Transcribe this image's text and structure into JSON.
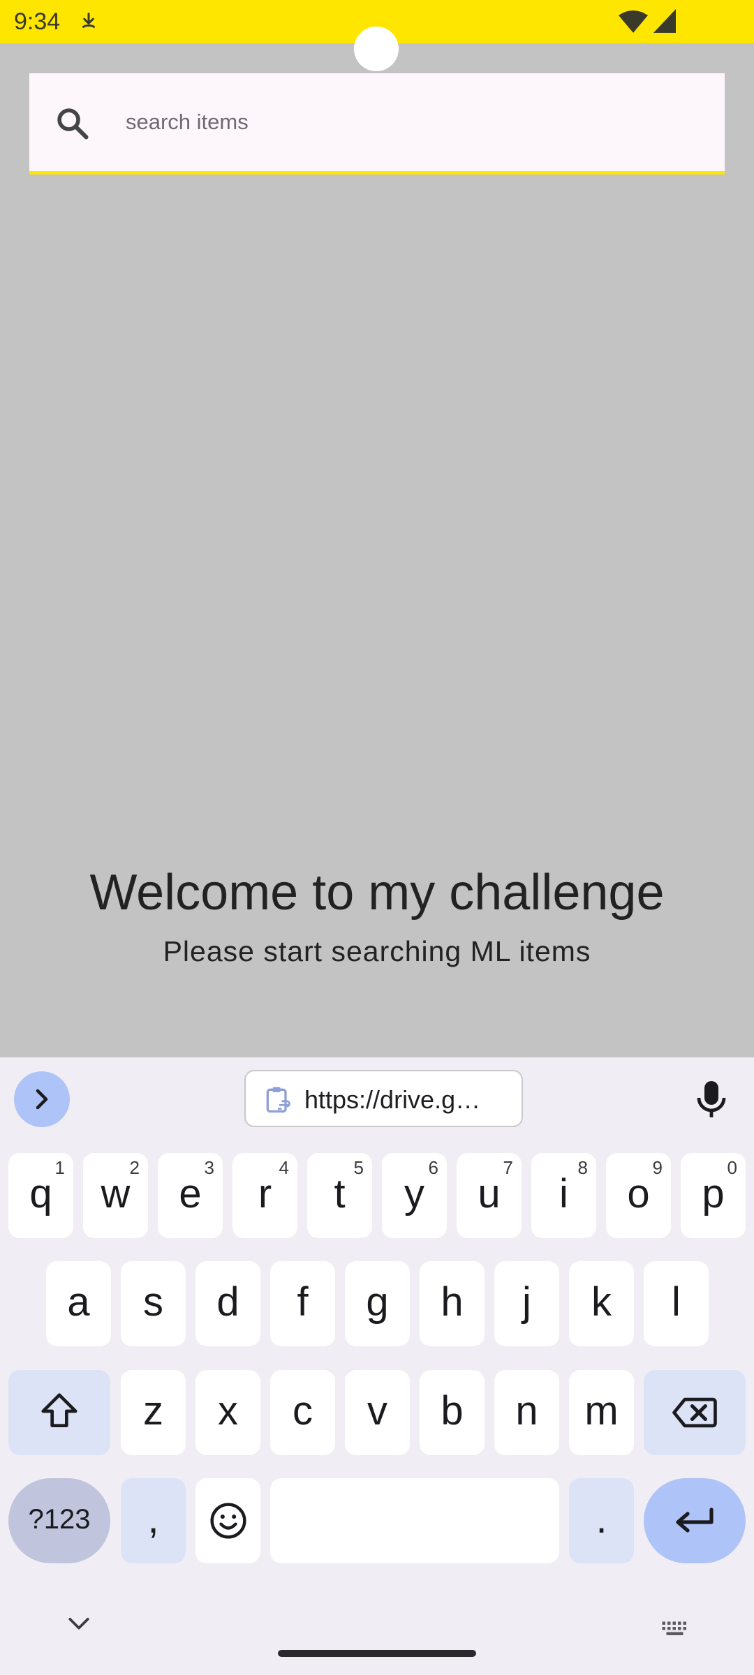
{
  "status_bar": {
    "time": "9:34",
    "icons": [
      "download-progress-icon",
      "wifi-icon",
      "cell-signal-icon"
    ]
  },
  "search": {
    "placeholder": "search items",
    "value": "",
    "icon": "search-icon"
  },
  "welcome": {
    "title": "Welcome to my challenge",
    "subtitle": "Please start searching ML items"
  },
  "keyboard": {
    "clipboard_suggestion": "https://drive.g…",
    "rows": [
      [
        {
          "label": "q",
          "hint": "1"
        },
        {
          "label": "w",
          "hint": "2"
        },
        {
          "label": "e",
          "hint": "3"
        },
        {
          "label": "r",
          "hint": "4"
        },
        {
          "label": "t",
          "hint": "5"
        },
        {
          "label": "y",
          "hint": "6"
        },
        {
          "label": "u",
          "hint": "7"
        },
        {
          "label": "i",
          "hint": "8"
        },
        {
          "label": "o",
          "hint": "9"
        },
        {
          "label": "p",
          "hint": "0"
        }
      ],
      [
        {
          "label": "a"
        },
        {
          "label": "s"
        },
        {
          "label": "d"
        },
        {
          "label": "f"
        },
        {
          "label": "g"
        },
        {
          "label": "h"
        },
        {
          "label": "j"
        },
        {
          "label": "k"
        },
        {
          "label": "l"
        }
      ],
      [
        {
          "label": "z"
        },
        {
          "label": "x"
        },
        {
          "label": "c"
        },
        {
          "label": "v"
        },
        {
          "label": "b"
        },
        {
          "label": "n"
        },
        {
          "label": "m"
        }
      ]
    ],
    "symbols_label": "?123",
    "comma_label": ",",
    "period_label": ".",
    "colors": {
      "key": "#ffffff",
      "modifier": "#dde3f6",
      "accent": "#aec3f7",
      "background": "#f0eef4"
    }
  },
  "colors": {
    "status_bar": "#ffe600",
    "page_background": "#c3c3c3",
    "search_background": "#fdf7fc",
    "search_underline": "#ffe600"
  }
}
